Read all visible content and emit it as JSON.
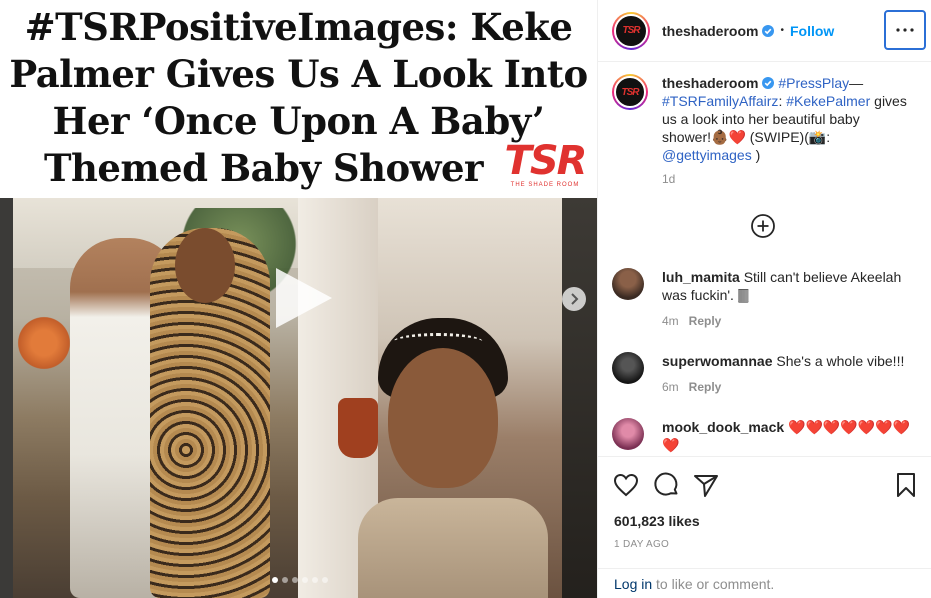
{
  "media": {
    "headline": {
      "line1": "#TSRPositiveImages: Keke",
      "line2": "Palmer Gives Us A Look Into",
      "line3": "Her ‘Once Upon A Baby’",
      "line4": "Themed Baby Shower"
    },
    "logo": {
      "mark": "TSR",
      "sub": "THE SHADE ROOM"
    },
    "carousel": {
      "slides": 6,
      "active": 0
    }
  },
  "header": {
    "avatar_text": "TSR",
    "username": "theshaderoom",
    "separator": "•",
    "follow_label": "Follow"
  },
  "caption": {
    "avatar_text": "TSR",
    "username": "theshaderoom",
    "tag1": "#PressPlay",
    "dash": "—",
    "tag2": "#TSRFamilyAffairz",
    "colon": ":",
    "tag3": "#KekePalmer",
    "text1": " gives us a look into her beautiful baby shower!👶🏾❤️ (SWIPE)(📸: ",
    "mention": "@gettyimages",
    "text2": " )",
    "time": "1d"
  },
  "comments": [
    {
      "username": "luh_mamita",
      "text": "Still can't believe Akeelah was fuckin'. 🀫",
      "time": "4m",
      "reply": "Reply",
      "avatar_color": "#6b4a3a"
    },
    {
      "username": "superwomannae",
      "text": "She's a whole vibe!!!",
      "time": "6m",
      "reply": "Reply",
      "avatar_color": "#2a2a2a"
    },
    {
      "username": "mook_dook_mack",
      "text": "❤️❤️❤️❤️❤️❤️❤️❤️",
      "time": "",
      "reply": "",
      "avatar_color": "#c25b8a"
    }
  ],
  "actions": {
    "likes": "601,823 likes",
    "posted": "1 DAY AGO"
  },
  "login": {
    "link": "Log in",
    "text": " to like or comment."
  }
}
